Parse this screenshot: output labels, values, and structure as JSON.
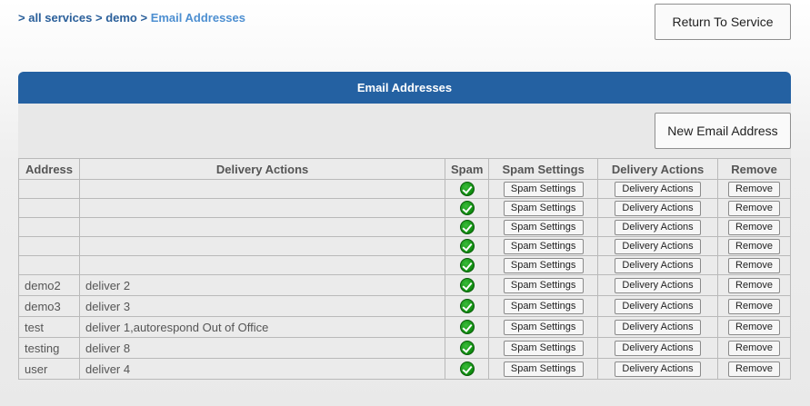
{
  "breadcrumb": {
    "prefix": ">",
    "items": [
      {
        "label": "all services"
      },
      {
        "label": "demo"
      },
      {
        "label": "Email Addresses"
      }
    ],
    "separator": ">"
  },
  "buttons": {
    "return_to_service": "Return To Service",
    "new_email_address": "New Email Address"
  },
  "panel": {
    "title": "Email Addresses"
  },
  "table": {
    "headers": {
      "address": "Address",
      "delivery_actions": "Delivery Actions",
      "spam": "Spam",
      "spam_settings": "Spam Settings",
      "delivery_actions_btn": "Delivery Actions",
      "remove": "Remove"
    },
    "row_buttons": {
      "spam_settings": "Spam Settings",
      "delivery_actions": "Delivery Actions",
      "remove": "Remove"
    },
    "rows": [
      {
        "address": "",
        "delivery": ""
      },
      {
        "address": "",
        "delivery": ""
      },
      {
        "address": "",
        "delivery": ""
      },
      {
        "address": "",
        "delivery": ""
      },
      {
        "address": "",
        "delivery": ""
      },
      {
        "address": "demo2",
        "delivery": "deliver 2"
      },
      {
        "address": "demo3",
        "delivery": "deliver 3"
      },
      {
        "address": "test",
        "delivery": "deliver 1,autorespond Out of Office"
      },
      {
        "address": "testing",
        "delivery": "deliver 8"
      },
      {
        "address": "user",
        "delivery": "deliver 4"
      }
    ]
  },
  "colors": {
    "header_bar": "#2461a2",
    "link": "#2a5f9a",
    "current_crumb": "#4d8fd1",
    "spam_ok": "#1a9a1a"
  },
  "icons": {
    "spam_status": "green-check-icon"
  }
}
